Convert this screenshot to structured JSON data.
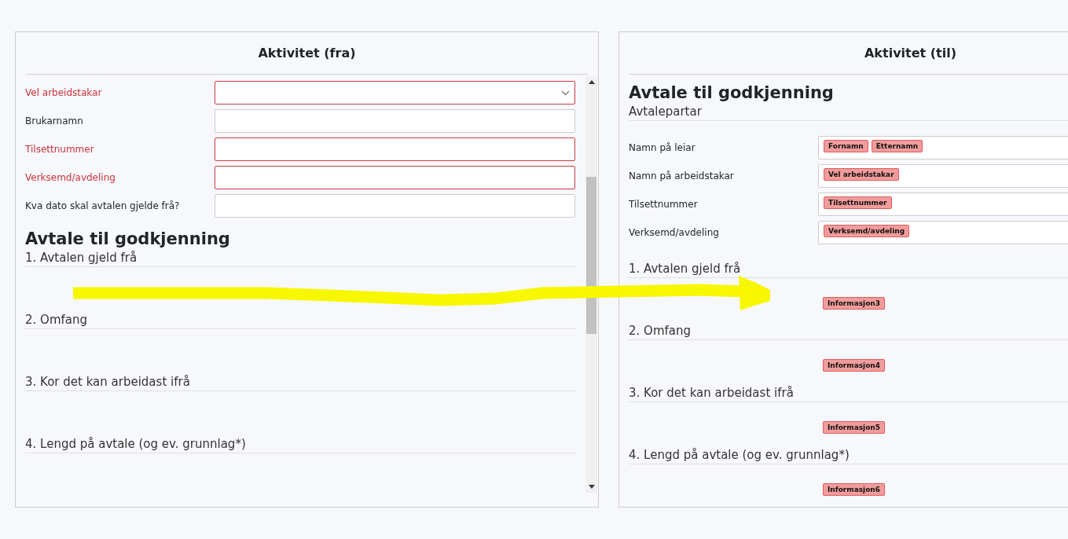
{
  "panels": [
    {
      "title": "Aktivitet (fra)",
      "kind": "form",
      "fields": [
        {
          "label": "Vel arbeidstakar",
          "kind": "select",
          "invalid": true
        },
        {
          "label": "Brukarnamn",
          "kind": "text",
          "invalid": false
        },
        {
          "label": "Tilsettnummer",
          "kind": "text",
          "invalid": true
        },
        {
          "label": "Verksemd/avdeling",
          "kind": "text",
          "invalid": true
        },
        {
          "label": "Kva dato skal avtalen gjelde frå?",
          "kind": "text",
          "invalid": false
        }
      ],
      "heading": "Avtale til godkjenning",
      "sections": [
        {
          "title": "1. Avtalen gjeld frå"
        },
        {
          "title": "2. Omfang"
        },
        {
          "title": "3. Kor det kan arbeidast ifrå"
        },
        {
          "title": "4. Lengd på avtale (og ev. grunnlag*)"
        }
      ]
    },
    {
      "title": "Aktivitet (til)",
      "kind": "template",
      "heading": "Avtale til godkjenning",
      "subheading": "Avtalepartar",
      "fields": [
        {
          "label": "Namn på leiar",
          "tags": [
            "Fornamn",
            "Etternamn"
          ]
        },
        {
          "label": "Namn på arbeidstakar",
          "tags": [
            "Vel arbeidstakar"
          ]
        },
        {
          "label": "Tilsettnummer",
          "tags": [
            "Tilsettnummer"
          ]
        },
        {
          "label": "Verksemd/avdeling",
          "tags": [
            "Verksemd/avdeling"
          ]
        }
      ],
      "sections": [
        {
          "title": "1. Avtalen gjeld frå",
          "tag": "Informasjon3"
        },
        {
          "title": "2. Omfang",
          "tag": "Informasjon4"
        },
        {
          "title": "3. Kor det kan arbeidast ifrå",
          "tag": "Informasjon5"
        },
        {
          "title": "4. Lengd på avtale (og ev. grunnlag*)",
          "tag": "Informasjon6"
        }
      ]
    }
  ]
}
